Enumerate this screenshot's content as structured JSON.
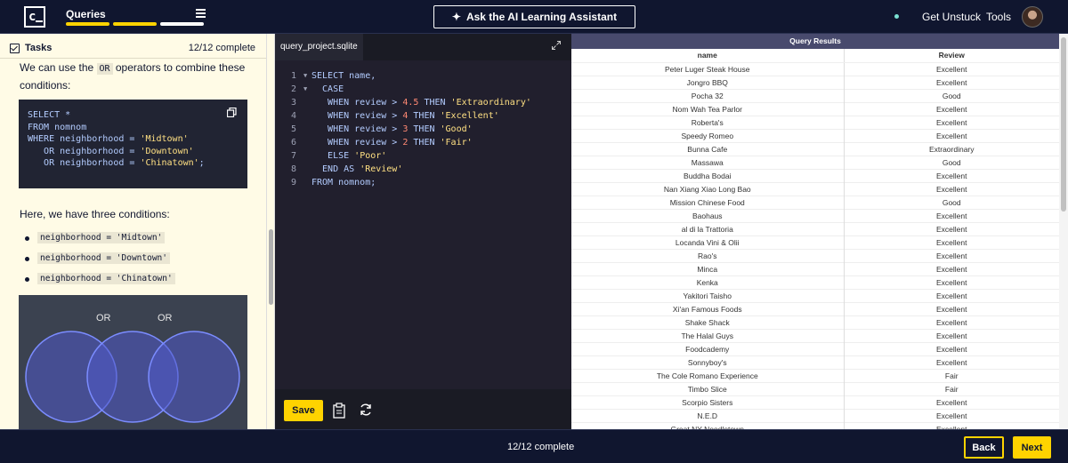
{
  "header": {
    "logo_text": "c",
    "title": "Queries",
    "progress_segments": [
      {
        "fill": 1.0,
        "color": "#ffd300"
      },
      {
        "fill": 1.0,
        "color": "#ffd300"
      },
      {
        "fill": 1.0,
        "color": "#ffffff"
      }
    ],
    "assistant_label": "Ask the AI Learning Assistant",
    "get_unstuck": "Get Unstuck",
    "tools": "Tools"
  },
  "tasks": {
    "label": "Tasks",
    "count": "12/12 complete"
  },
  "lesson": {
    "intro_before": "We can use the ",
    "intro_code": "OR",
    "intro_after": " operators to combine these conditions:",
    "code_lines": [
      [
        {
          "t": "SELECT *",
          "c": "plain"
        }
      ],
      [
        {
          "t": "FROM nomnom",
          "c": "plain"
        }
      ],
      [
        {
          "t": "WHERE neighborhood = ",
          "c": "plain"
        },
        {
          "t": "'Midtown'",
          "c": "str"
        }
      ],
      [
        {
          "t": "   OR neighborhood = ",
          "c": "plain"
        },
        {
          "t": "'Downtown'",
          "c": "str"
        }
      ],
      [
        {
          "t": "   OR neighborhood = ",
          "c": "plain"
        },
        {
          "t": "'Chinatown'",
          "c": "str"
        },
        {
          "t": ";",
          "c": "plain"
        }
      ]
    ],
    "conditions_text": "Here, we have three conditions:",
    "bullets": [
      "neighborhood = 'Midtown'",
      "neighborhood = 'Downtown'",
      "neighborhood = 'Chinatown'"
    ],
    "venn_labels": [
      "OR",
      "OR"
    ]
  },
  "editor": {
    "filename": "query_project.sqlite",
    "lines": [
      {
        "n": "1",
        "fold": true,
        "parts": [
          {
            "t": "SELECT name,",
            "c": "kw"
          }
        ]
      },
      {
        "n": "2",
        "fold": true,
        "parts": [
          {
            "t": "  CASE",
            "c": "kw"
          }
        ]
      },
      {
        "n": "3",
        "fold": false,
        "parts": [
          {
            "t": "   WHEN review > ",
            "c": "kw"
          },
          {
            "t": "4.5",
            "c": "num"
          },
          {
            "t": " THEN ",
            "c": "kw"
          },
          {
            "t": "'Extraordinary'",
            "c": "sq"
          }
        ]
      },
      {
        "n": "4",
        "fold": false,
        "parts": [
          {
            "t": "   WHEN review > ",
            "c": "kw"
          },
          {
            "t": "4",
            "c": "num"
          },
          {
            "t": " THEN ",
            "c": "kw"
          },
          {
            "t": "'Excellent'",
            "c": "sq"
          }
        ]
      },
      {
        "n": "5",
        "fold": false,
        "parts": [
          {
            "t": "   WHEN review > ",
            "c": "kw"
          },
          {
            "t": "3",
            "c": "num"
          },
          {
            "t": " THEN ",
            "c": "kw"
          },
          {
            "t": "'Good'",
            "c": "sq"
          }
        ]
      },
      {
        "n": "6",
        "fold": false,
        "parts": [
          {
            "t": "   WHEN review > ",
            "c": "kw"
          },
          {
            "t": "2",
            "c": "num"
          },
          {
            "t": " THEN ",
            "c": "kw"
          },
          {
            "t": "'Fair'",
            "c": "sq"
          }
        ]
      },
      {
        "n": "7",
        "fold": false,
        "parts": [
          {
            "t": "   ELSE ",
            "c": "kw"
          },
          {
            "t": "'Poor'",
            "c": "sq"
          }
        ]
      },
      {
        "n": "8",
        "fold": false,
        "parts": [
          {
            "t": "  END AS ",
            "c": "kw"
          },
          {
            "t": "'Review'",
            "c": "sq"
          }
        ]
      },
      {
        "n": "9",
        "fold": false,
        "parts": [
          {
            "t": "FROM nomnom;",
            "c": "kw"
          }
        ]
      }
    ],
    "save_label": "Save"
  },
  "results": {
    "title": "Query Results",
    "columns": [
      "name",
      "Review"
    ],
    "rows": [
      [
        "Peter Luger Steak House",
        "Excellent"
      ],
      [
        "Jongro BBQ",
        "Excellent"
      ],
      [
        "Pocha 32",
        "Good"
      ],
      [
        "Nom Wah Tea Parlor",
        "Excellent"
      ],
      [
        "Roberta's",
        "Excellent"
      ],
      [
        "Speedy Romeo",
        "Excellent"
      ],
      [
        "Bunna Cafe",
        "Extraordinary"
      ],
      [
        "Massawa",
        "Good"
      ],
      [
        "Buddha Bodai",
        "Excellent"
      ],
      [
        "Nan Xiang Xiao Long Bao",
        "Excellent"
      ],
      [
        "Mission Chinese Food",
        "Good"
      ],
      [
        "Baohaus",
        "Excellent"
      ],
      [
        "al di la Trattoria",
        "Excellent"
      ],
      [
        "Locanda Vini & Olii",
        "Excellent"
      ],
      [
        "Rao's",
        "Excellent"
      ],
      [
        "Minca",
        "Excellent"
      ],
      [
        "Kenka",
        "Excellent"
      ],
      [
        "Yakitori Taisho",
        "Excellent"
      ],
      [
        "Xi'an Famous Foods",
        "Excellent"
      ],
      [
        "Shake Shack",
        "Excellent"
      ],
      [
        "The Halal Guys",
        "Excellent"
      ],
      [
        "Foodcademy",
        "Excellent"
      ],
      [
        "Sonnyboy's",
        "Excellent"
      ],
      [
        "The Cole Romano Experience",
        "Fair"
      ],
      [
        "Timbo Slice",
        "Fair"
      ],
      [
        "Scorpio Sisters",
        "Excellent"
      ],
      [
        "N.E.D",
        "Excellent"
      ],
      [
        "Great NY Noodletown",
        "Excellent"
      ]
    ]
  },
  "footer": {
    "status": "12/12 complete",
    "back_label": "Back",
    "next_label": "Next"
  }
}
